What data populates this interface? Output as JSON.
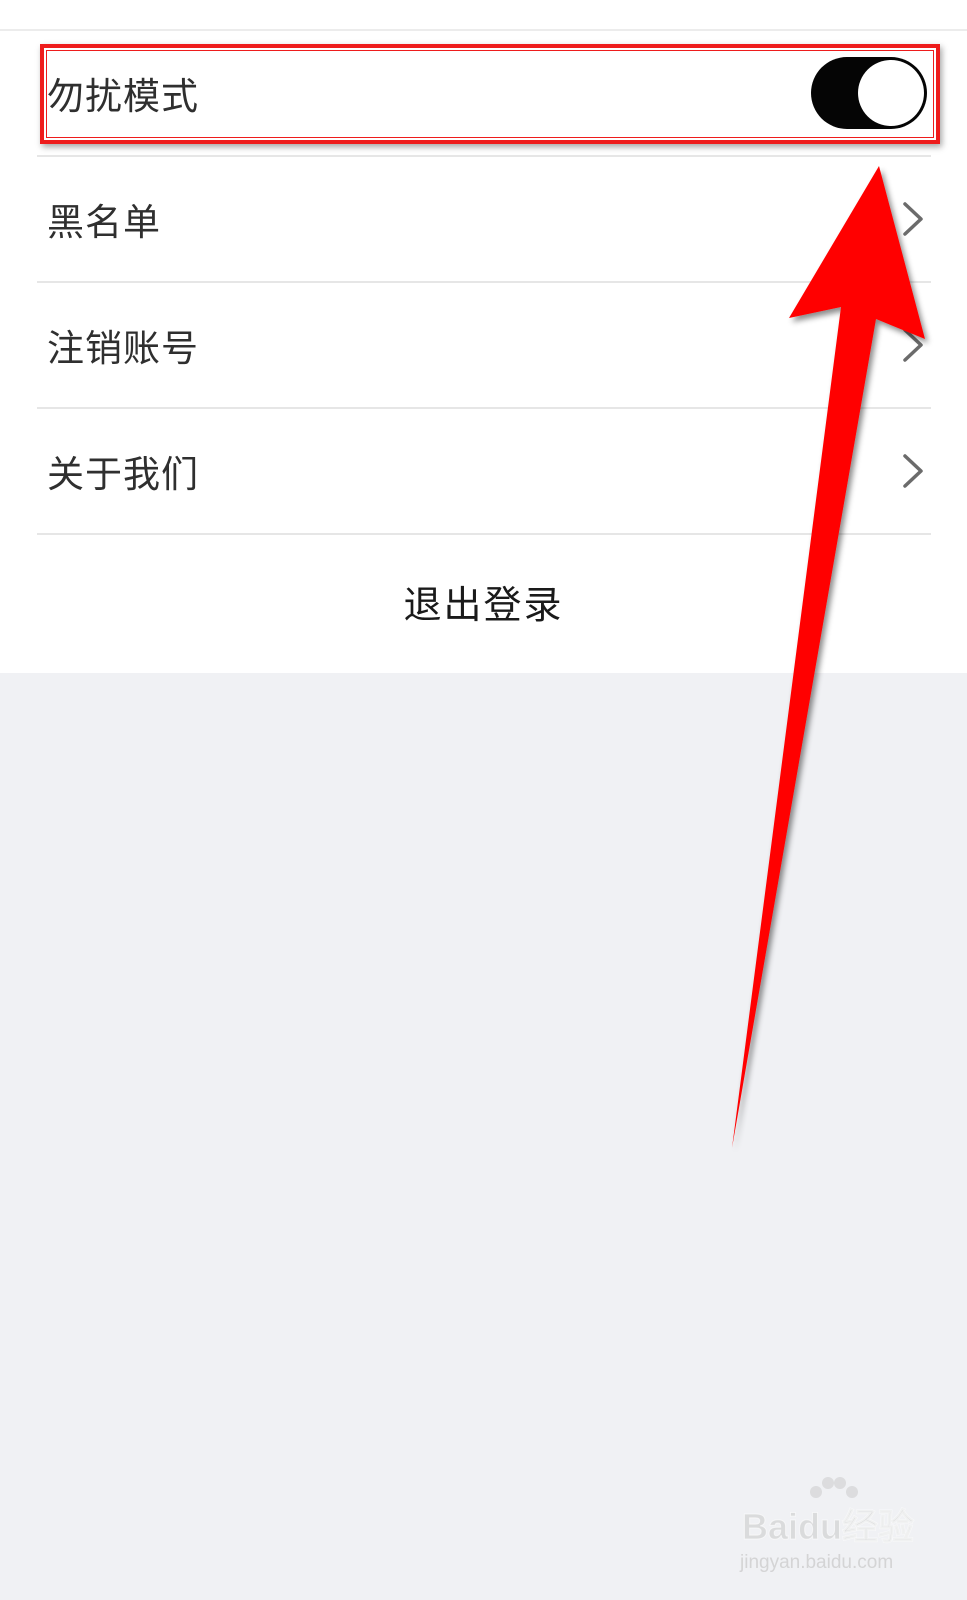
{
  "settings": {
    "items": [
      {
        "label": "勿扰模式",
        "control": "toggle",
        "toggle_on": true
      },
      {
        "label": "黑名单",
        "control": "chevron"
      },
      {
        "label": "注销账号",
        "control": "chevron"
      },
      {
        "label": "关于我们",
        "control": "chevron"
      }
    ],
    "logout_label": "退出登录"
  },
  "annotation": {
    "highlight_color": "#ee1c1c",
    "arrow_color": "#ff0000"
  },
  "watermark": {
    "brand": "Baidu经验",
    "url": "jingyan.baidu.com"
  },
  "colors": {
    "page_background": "#f0f1f4",
    "toggle_on": "#050505"
  }
}
